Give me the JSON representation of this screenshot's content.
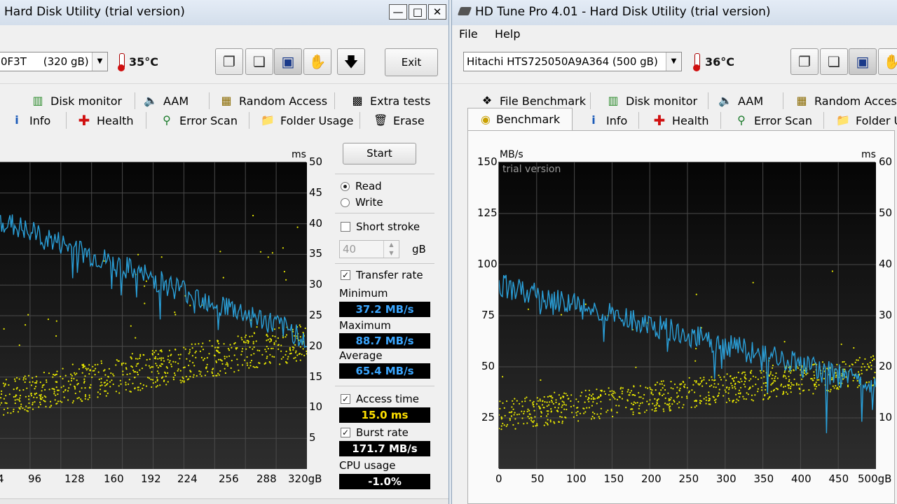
{
  "left": {
    "title": "Hard Disk Utility (trial version)",
    "drive_name": "0F3T     (320 gB)",
    "temperature": "35°C",
    "exit_label": "Exit",
    "tabs_row1": [
      {
        "label": "Disk monitor",
        "icon": "disk-monitor-icon"
      },
      {
        "label": "AAM",
        "icon": "speaker-icon"
      },
      {
        "label": "Random Access",
        "icon": "random-access-icon"
      },
      {
        "label": "Extra tests",
        "icon": "extra-tests-icon"
      }
    ],
    "tabs_row2": [
      {
        "label": "Info",
        "icon": "info-icon"
      },
      {
        "label": "Health",
        "icon": "health-cross-icon"
      },
      {
        "label": "Error Scan",
        "icon": "magnifier-icon"
      },
      {
        "label": "Folder Usage",
        "icon": "folder-icon"
      },
      {
        "label": "Erase",
        "icon": "trash-icon"
      }
    ],
    "chart_data": {
      "type": "line",
      "xlabel": "gB",
      "x_ticks": [
        "4",
        "96",
        "128",
        "160",
        "192",
        "224",
        "256",
        "288",
        "320gB"
      ],
      "y2_label": "ms",
      "y2_ticks": [
        "50",
        "45",
        "40",
        "35",
        "30",
        "25",
        "20",
        "15",
        "10",
        "5"
      ],
      "ylim_ms": [
        0,
        50
      ],
      "series": [
        {
          "name": "Transfer rate",
          "color": "#2a9fd8",
          "start": 40.5,
          "end": 21.5
        },
        {
          "name": "Access time",
          "color": "#e8e800",
          "min": 9,
          "max": 26
        }
      ]
    },
    "panel": {
      "start_label": "Start",
      "read_label": "Read",
      "write_label": "Write",
      "short_stroke_label": "Short stroke",
      "short_stroke_value": "40",
      "gb_label": "gB",
      "transfer_rate_label": "Transfer rate",
      "minimum_label": "Minimum",
      "minimum_value": "37.2 MB/s",
      "maximum_label": "Maximum",
      "maximum_value": "88.7 MB/s",
      "average_label": "Average",
      "average_value": "65.4 MB/s",
      "access_time_label": "Access time",
      "access_time_value": "15.0 ms",
      "burst_rate_label": "Burst rate",
      "burst_rate_value": "171.7 MB/s",
      "cpu_usage_label": "CPU usage",
      "cpu_usage_value": "-1.0%"
    }
  },
  "right": {
    "title": "HD Tune Pro 4.01 - Hard Disk Utility (trial version)",
    "menu_file": "File",
    "menu_help": "Help",
    "drive_name": "Hitachi HTS725050A9A364 (500 gB)",
    "temperature": "36°C",
    "tabs_row1": [
      {
        "label": "File Benchmark",
        "icon": "file-benchmark-icon"
      },
      {
        "label": "Disk monitor",
        "icon": "disk-monitor-icon"
      },
      {
        "label": "AAM",
        "icon": "speaker-icon"
      },
      {
        "label": "Random Access",
        "icon": "random-access-icon"
      }
    ],
    "tabs_row2": [
      {
        "label": "Benchmark",
        "icon": "benchmark-icon"
      },
      {
        "label": "Info",
        "icon": "info-icon"
      },
      {
        "label": "Health",
        "icon": "health-cross-icon"
      },
      {
        "label": "Error Scan",
        "icon": "magnifier-icon"
      },
      {
        "label": "Folder U",
        "icon": "folder-icon"
      }
    ],
    "watermark": "trial version",
    "chart_data": {
      "type": "line",
      "ylabel": "MB/s",
      "y_ticks": [
        "150",
        "125",
        "100",
        "75",
        "50",
        "25"
      ],
      "ylim": [
        0,
        150
      ],
      "y2_label": "ms",
      "y2_ticks": [
        "60",
        "50",
        "40",
        "30",
        "20",
        "10"
      ],
      "ylim_ms": [
        0,
        60
      ],
      "x_ticks": [
        "0",
        "50",
        "100",
        "150",
        "200",
        "250",
        "300",
        "350",
        "400",
        "450",
        "500gB"
      ],
      "xlim": [
        0,
        500
      ],
      "series": [
        {
          "name": "Transfer rate",
          "color": "#2a9fd8",
          "start": 90,
          "end": 41
        },
        {
          "name": "Access time",
          "color": "#e8e800",
          "min": 8,
          "max": 24
        }
      ]
    }
  }
}
